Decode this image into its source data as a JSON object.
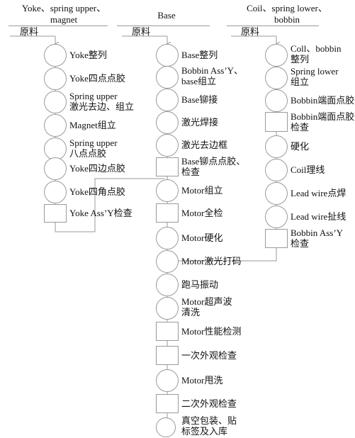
{
  "diagram": {
    "title_present": false,
    "raw_material_label": "原料",
    "columns": [
      {
        "id": "col-yoke",
        "header": "Yoke、spring upper、\nmagnet",
        "nodes": [
          {
            "label": "Yoke整列",
            "shape": "circle"
          },
          {
            "label": "Yoke四点点胶",
            "shape": "circle"
          },
          {
            "label": "Spring upper\n激光去边、组立",
            "shape": "circle"
          },
          {
            "label": "Magnet组立",
            "shape": "circle"
          },
          {
            "label": "Spring upper\n八点点胶",
            "shape": "circle"
          },
          {
            "label": "Yoke四边点胶",
            "shape": "circle"
          },
          {
            "label": "Yoke四角点胶",
            "shape": "circle"
          },
          {
            "label": "Yoke Ass’Y检查",
            "shape": "square"
          }
        ]
      },
      {
        "id": "col-base",
        "header": "Base",
        "nodes": [
          {
            "label": "Base整列",
            "shape": "circle"
          },
          {
            "label": "Bobbin Ass’Y、\nbase组立",
            "shape": "circle"
          },
          {
            "label": "Base铆接",
            "shape": "circle"
          },
          {
            "label": "激光焊接",
            "shape": "circle"
          },
          {
            "label": "激光去边框",
            "shape": "circle"
          },
          {
            "label": "Base铆点点胶、\n检查",
            "shape": "square"
          },
          {
            "label": "Motor组立",
            "shape": "circle"
          },
          {
            "label": "Motor全检",
            "shape": "square"
          },
          {
            "label": "Motor硬化",
            "shape": "circle"
          },
          {
            "label": "Motor激光打码",
            "shape": "circle"
          },
          {
            "label": "跑马振动",
            "shape": "circle"
          },
          {
            "label": "Motor超声波\n清洗",
            "shape": "circle"
          },
          {
            "label": "Motor性能检测",
            "shape": "square"
          },
          {
            "label": "一次外观检查",
            "shape": "square"
          },
          {
            "label": "Motor甩洗",
            "shape": "circle"
          },
          {
            "label": "二次外观检查",
            "shape": "square"
          },
          {
            "label": "真空包装、贴\n标签及入库",
            "shape": "circle"
          }
        ]
      },
      {
        "id": "col-coil",
        "header": "Coil、spring lower、\nbobbin",
        "nodes": [
          {
            "label": "Coll、bobbin\n整列",
            "shape": "circle"
          },
          {
            "label": "Spring lower\n组立",
            "shape": "circle"
          },
          {
            "label": "Bobbin端面点胶",
            "shape": "circle"
          },
          {
            "label": "Bobbin端面点胶\n检查",
            "shape": "square"
          },
          {
            "label": "硬化",
            "shape": "circle"
          },
          {
            "label": "Coil理线",
            "shape": "circle"
          },
          {
            "label": "Lead wire点焊",
            "shape": "circle"
          },
          {
            "label": "Lead wire扯线",
            "shape": "circle"
          },
          {
            "label": "Bobbin Ass’Y\n检查",
            "shape": "square"
          }
        ]
      }
    ],
    "colors": {
      "line": "#9a9a9a",
      "text": "#111111",
      "background": "#ffffff"
    }
  }
}
